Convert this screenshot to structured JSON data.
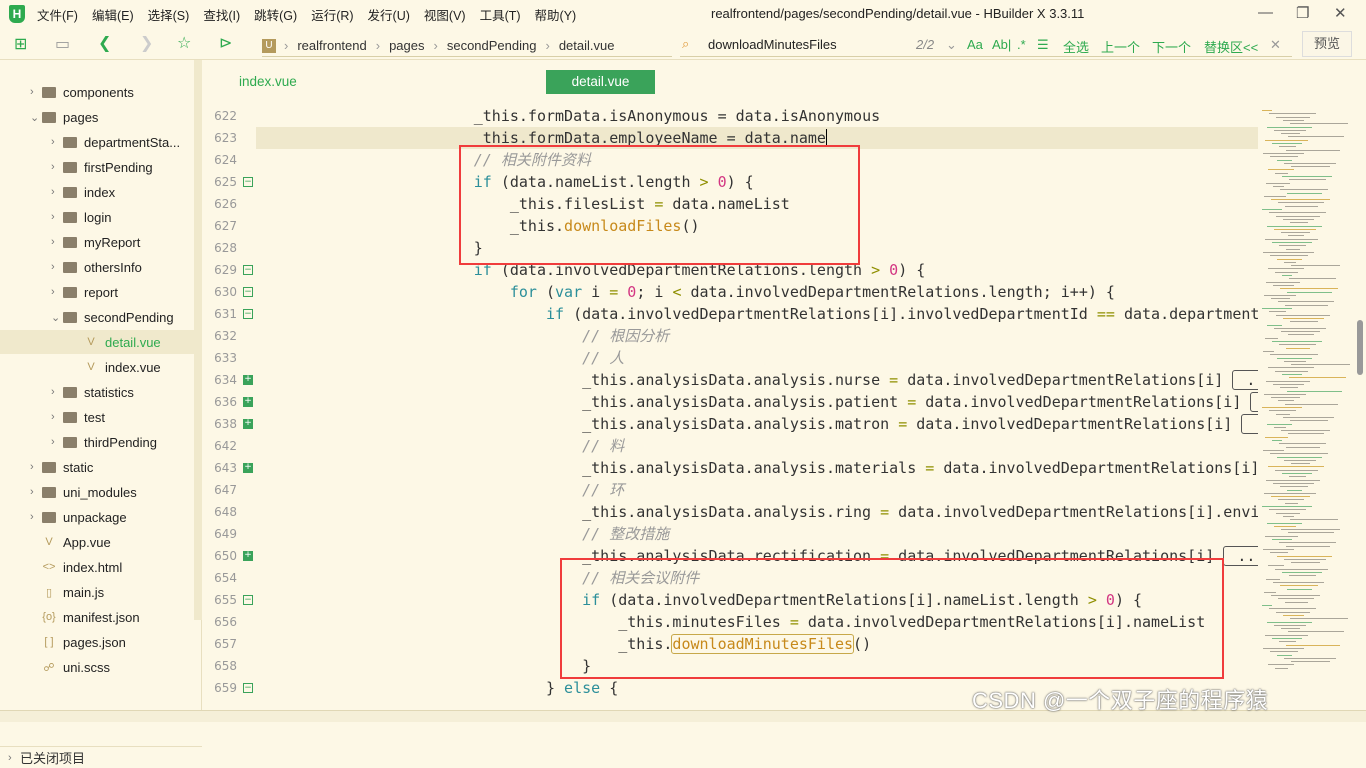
{
  "app": {
    "logo": "H",
    "title": "realfrontend/pages/secondPending/detail.vue - HBuilder X 3.3.11"
  },
  "menu": [
    "文件(F)",
    "编辑(E)",
    "选择(S)",
    "查找(I)",
    "跳转(G)",
    "运行(R)",
    "发行(U)",
    "视图(V)",
    "工具(T)",
    "帮助(Y)"
  ],
  "window_controls": {
    "minimize": "—",
    "restore": "❐",
    "close": "✕"
  },
  "breadcrumb": {
    "badge": "U",
    "items": [
      "realfrontend",
      "pages",
      "secondPending",
      "detail.vue"
    ]
  },
  "find": {
    "query": "downloadMinutesFiles",
    "count": "2/2",
    "case": "Aa",
    "word": "Ab|",
    "regex": ".*",
    "lines": "☰",
    "select_all": "全选",
    "prev": "上一个",
    "next": "下一个",
    "replace": "替换区<<",
    "close": "✕"
  },
  "preview_label": "预览",
  "sidebar": {
    "items": [
      {
        "label": "components",
        "type": "folder",
        "depth": 1,
        "open": false
      },
      {
        "label": "pages",
        "type": "folder",
        "depth": 1,
        "open": true
      },
      {
        "label": "departmentSta...",
        "type": "folder",
        "depth": 2,
        "open": false
      },
      {
        "label": "firstPending",
        "type": "folder",
        "depth": 2,
        "open": false
      },
      {
        "label": "index",
        "type": "folder",
        "depth": 2,
        "open": false
      },
      {
        "label": "login",
        "type": "folder",
        "depth": 2,
        "open": false
      },
      {
        "label": "myReport",
        "type": "folder",
        "depth": 2,
        "open": false
      },
      {
        "label": "othersInfo",
        "type": "folder",
        "depth": 2,
        "open": false
      },
      {
        "label": "report",
        "type": "folder",
        "depth": 2,
        "open": false
      },
      {
        "label": "secondPending",
        "type": "folder",
        "depth": 2,
        "open": true
      },
      {
        "label": "detail.vue",
        "type": "vue",
        "depth": 3,
        "selected": true
      },
      {
        "label": "index.vue",
        "type": "vue",
        "depth": 3
      },
      {
        "label": "statistics",
        "type": "folder",
        "depth": 2,
        "open": false
      },
      {
        "label": "test",
        "type": "folder",
        "depth": 2,
        "open": false
      },
      {
        "label": "thirdPending",
        "type": "folder",
        "depth": 2,
        "open": false
      },
      {
        "label": "static",
        "type": "folder",
        "depth": 1,
        "open": false
      },
      {
        "label": "uni_modules",
        "type": "folder",
        "depth": 1,
        "open": false
      },
      {
        "label": "unpackage",
        "type": "folder",
        "depth": 1,
        "open": false
      },
      {
        "label": "App.vue",
        "type": "vue",
        "depth": 1
      },
      {
        "label": "index.html",
        "type": "html",
        "depth": 1
      },
      {
        "label": "main.js",
        "type": "js",
        "depth": 1
      },
      {
        "label": "manifest.json",
        "type": "json",
        "depth": 1
      },
      {
        "label": "pages.json",
        "type": "json2",
        "depth": 1
      },
      {
        "label": "uni.scss",
        "type": "scss",
        "depth": 1
      }
    ],
    "closed_projects": "已关闭项目"
  },
  "tabs": [
    {
      "label": "index.vue",
      "active": false
    },
    {
      "label": "detail.vue",
      "active": true
    }
  ],
  "code_lines": [
    {
      "n": "622",
      "fold": "",
      "t": [
        [
          "                        _this.formData.isAnonymous ",
          ""
        ],
        [
          "=",
          ""
        ],
        [
          " data.isAnonymous",
          ""
        ]
      ]
    },
    {
      "n": "623",
      "fold": "",
      "t": [
        [
          "                         this.formData.employeeName ",
          ""
        ],
        [
          "=",
          ""
        ],
        [
          " data.name",
          ""
        ]
      ]
    },
    {
      "n": "624",
      "fold": "",
      "t": [
        [
          "                        ",
          ""
        ],
        [
          "// 相关附件资料",
          "cm"
        ]
      ]
    },
    {
      "n": "625",
      "fold": "minus",
      "t": [
        [
          "                        ",
          ""
        ],
        [
          "if",
          "kw"
        ],
        [
          " (data.nameList.length ",
          ""
        ],
        [
          ">",
          "op"
        ],
        [
          " ",
          ""
        ],
        [
          "0",
          "num"
        ],
        [
          ") {",
          ""
        ]
      ]
    },
    {
      "n": "626",
      "fold": "",
      "t": [
        [
          "                            _this.filesList ",
          ""
        ],
        [
          "=",
          "op"
        ],
        [
          " data.nameList",
          ""
        ]
      ]
    },
    {
      "n": "627",
      "fold": "",
      "t": [
        [
          "                            _this.",
          ""
        ],
        [
          "downloadFiles",
          "fn"
        ],
        [
          "()",
          ""
        ]
      ]
    },
    {
      "n": "628",
      "fold": "",
      "t": [
        [
          "                        }",
          ""
        ]
      ]
    },
    {
      "n": "629",
      "fold": "minus",
      "t": [
        [
          "                        ",
          ""
        ],
        [
          "if",
          "kw"
        ],
        [
          " (data.involvedDepartmentRelations.length ",
          ""
        ],
        [
          ">",
          "op"
        ],
        [
          " ",
          ""
        ],
        [
          "0",
          "num"
        ],
        [
          ") {",
          ""
        ]
      ]
    },
    {
      "n": "630",
      "fold": "minus",
      "t": [
        [
          "                            ",
          ""
        ],
        [
          "for",
          "kw"
        ],
        [
          " (",
          ""
        ],
        [
          "var",
          "kw"
        ],
        [
          " i ",
          ""
        ],
        [
          "=",
          "op"
        ],
        [
          " ",
          ""
        ],
        [
          "0",
          "num"
        ],
        [
          "; i ",
          ""
        ],
        [
          "<",
          "op"
        ],
        [
          " data.involvedDepartmentRelations.length; i++) {",
          ""
        ]
      ]
    },
    {
      "n": "631",
      "fold": "minus",
      "t": [
        [
          "                                ",
          ""
        ],
        [
          "if",
          "kw"
        ],
        [
          " (data.involvedDepartmentRelations[i].involvedDepartmentId ",
          ""
        ],
        [
          "==",
          "op"
        ],
        [
          " data.departmentId",
          ""
        ]
      ]
    },
    {
      "n": "632",
      "fold": "",
      "t": [
        [
          "                                    ",
          ""
        ],
        [
          "// 根因分析",
          "cm"
        ]
      ]
    },
    {
      "n": "633",
      "fold": "",
      "t": [
        [
          "                                    ",
          ""
        ],
        [
          "// 人",
          "cm"
        ]
      ]
    },
    {
      "n": "634",
      "fold": "plus",
      "t": [
        [
          "                                    _this.analysisData.analysis.nurse ",
          ""
        ],
        [
          "=",
          "op"
        ],
        [
          " data.involvedDepartmentRelations[i] ",
          ""
        ],
        [
          " ... ",
          "ell"
        ]
      ]
    },
    {
      "n": "636",
      "fold": "plus",
      "t": [
        [
          "                                    _this.analysisData.analysis.patient ",
          ""
        ],
        [
          "=",
          "op"
        ],
        [
          " data.involvedDepartmentRelations[i] ",
          ""
        ],
        [
          " ... ",
          "ell"
        ]
      ]
    },
    {
      "n": "638",
      "fold": "plus",
      "t": [
        [
          "                                    _this.analysisData.analysis.matron ",
          ""
        ],
        [
          "=",
          "op"
        ],
        [
          " data.involvedDepartmentRelations[i] ",
          ""
        ],
        [
          " ... ",
          "ell"
        ]
      ]
    },
    {
      "n": "642",
      "fold": "",
      "t": [
        [
          "                                    ",
          ""
        ],
        [
          "// 料",
          "cm"
        ]
      ]
    },
    {
      "n": "643",
      "fold": "plus",
      "t": [
        [
          "                                    _this.analysisData.analysis.materials ",
          ""
        ],
        [
          "=",
          "op"
        ],
        [
          " data.involvedDepartmentRelations[i] ",
          ""
        ],
        [
          " ... ",
          "ell"
        ]
      ]
    },
    {
      "n": "647",
      "fold": "",
      "t": [
        [
          "                                    ",
          ""
        ],
        [
          "// 环",
          "cm"
        ]
      ]
    },
    {
      "n": "648",
      "fold": "",
      "t": [
        [
          "                                    _this.analysisData.analysis.ring ",
          ""
        ],
        [
          "=",
          "op"
        ],
        [
          " data.involvedDepartmentRelations[i].environment",
          ""
        ]
      ]
    },
    {
      "n": "649",
      "fold": "",
      "t": [
        [
          "                                    ",
          ""
        ],
        [
          "// 整改措施",
          "cm"
        ]
      ]
    },
    {
      "n": "650",
      "fold": "plus",
      "t": [
        [
          "                                    _this.analysisData.rectification ",
          ""
        ],
        [
          "=",
          "op"
        ],
        [
          " data.involvedDepartmentRelations[i] ",
          ""
        ],
        [
          " ... ",
          "ell"
        ]
      ]
    },
    {
      "n": "654",
      "fold": "",
      "t": [
        [
          "                                    ",
          ""
        ],
        [
          "// 相关会议附件",
          "cm"
        ]
      ]
    },
    {
      "n": "655",
      "fold": "minus",
      "t": [
        [
          "                                    ",
          ""
        ],
        [
          "if",
          "kw"
        ],
        [
          " (data.involvedDepartmentRelations[i].nameList.length ",
          ""
        ],
        [
          ">",
          "op"
        ],
        [
          " ",
          ""
        ],
        [
          "0",
          "num"
        ],
        [
          ") {",
          ""
        ]
      ]
    },
    {
      "n": "656",
      "fold": "",
      "t": [
        [
          "                                        _this.minutesFiles ",
          ""
        ],
        [
          "=",
          "op"
        ],
        [
          " data.involvedDepartmentRelations[i].nameList",
          ""
        ]
      ]
    },
    {
      "n": "657",
      "fold": "",
      "t": [
        [
          "                                        _this.",
          ""
        ],
        [
          "downloadMinutesFiles",
          "fn hl"
        ],
        [
          "()",
          ""
        ]
      ]
    },
    {
      "n": "658",
      "fold": "",
      "t": [
        [
          "                                    }",
          ""
        ]
      ]
    },
    {
      "n": "659",
      "fold": "minus",
      "t": [
        [
          "                                } ",
          ""
        ],
        [
          "else",
          "kw"
        ],
        [
          " {",
          ""
        ]
      ]
    }
  ],
  "watermark": "CSDN @一个双子座的程序猿",
  "colors": {
    "accent": "#2eaa4f",
    "background": "#fdf8e6",
    "annotation": "#f03c3c"
  }
}
